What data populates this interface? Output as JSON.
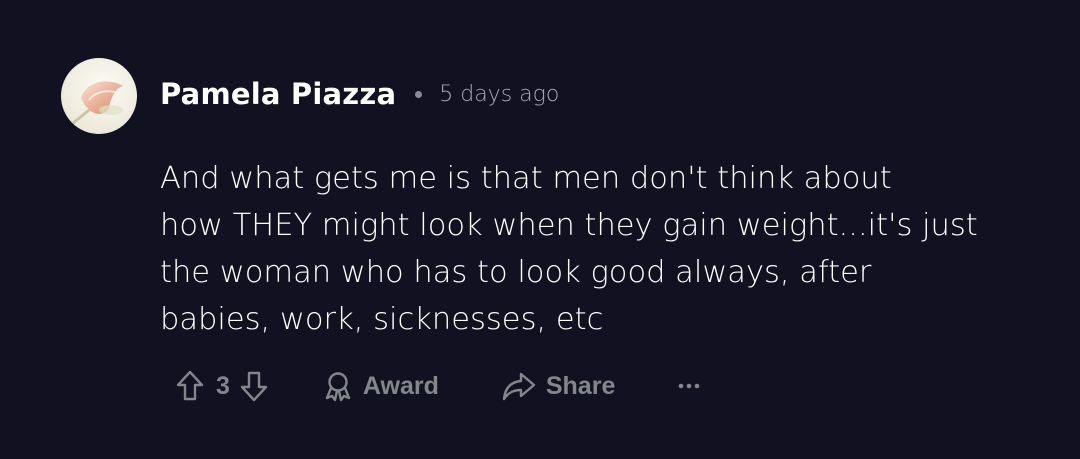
{
  "comment": {
    "author": "Pamela Piazza",
    "time": "5 days ago",
    "text": "And what gets me is that men don't think about\nhow THEY might look when they gain weight...it's just\nthe woman who has to look good always, after\nbabies, work, sicknesses, etc"
  },
  "actions": {
    "vote_count": "3",
    "award_label": "Award",
    "share_label": "Share",
    "more_label": "..."
  },
  "icons": {
    "upvote": "arrow-up-outline-icon",
    "downvote": "arrow-down-outline-icon",
    "award": "award-ribbon-icon",
    "share": "share-arrow-icon",
    "more": "ellipsis-icon"
  },
  "colors": {
    "background": "#111122",
    "text": "#ffffff",
    "muted": "#84868d"
  }
}
